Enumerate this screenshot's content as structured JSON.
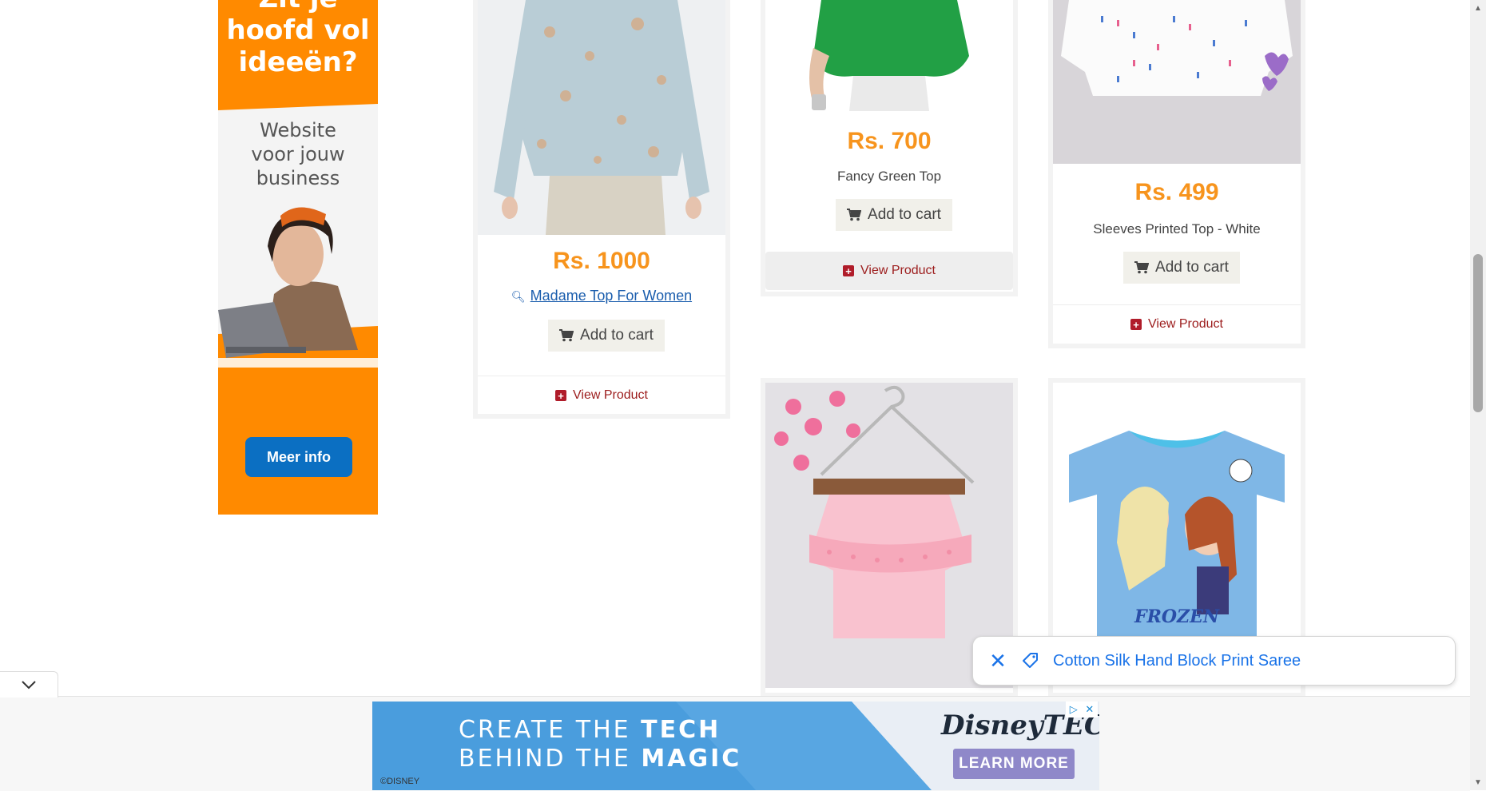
{
  "side_ad": {
    "headline": "Zit je hoofd vol ideeën?",
    "headline_lines": [
      "Zit je",
      "hoofd vol",
      "ideeën?"
    ],
    "sub_lines": [
      "Website",
      "voor jouw",
      "business"
    ],
    "cta": "Meer info",
    "colors": {
      "background": "#ff8a00",
      "button": "#0b6fc2"
    }
  },
  "products": [
    {
      "price": "Rs. 1000",
      "name": "Madame Top For Women",
      "add_to_cart": "Add to cart",
      "view": "View Product"
    },
    {
      "price": "Rs. 700",
      "name": "Fancy Green Top",
      "add_to_cart": "Add to cart",
      "view": "View Product"
    },
    {
      "price": "Rs. 499",
      "name": "Sleeves Printed Top - White",
      "add_to_cart": "Add to cart",
      "view": "View Product"
    }
  ],
  "product_images": {
    "pink_top": "pink cold-shoulder top on hanger",
    "frozen_tshirt_text": "FROZEN",
    "frozen_brand": "Disney"
  },
  "suggestion_chip": {
    "label": "Cotton Silk Hand Block Print Saree",
    "icon": "tag-icon"
  },
  "bottom_banner": {
    "line1_a": "CREATE THE ",
    "line1_b": "TECH",
    "line2_a": "BEHIND THE ",
    "line2_b": "MAGIC",
    "brand": "DisneyTECH",
    "cta": "LEARN MORE",
    "copyright": "©DISNEY"
  },
  "colors": {
    "price": "#f7941d",
    "link": "#1a5dad",
    "view": "#9c1c1c",
    "chip": "#1a73e8"
  }
}
